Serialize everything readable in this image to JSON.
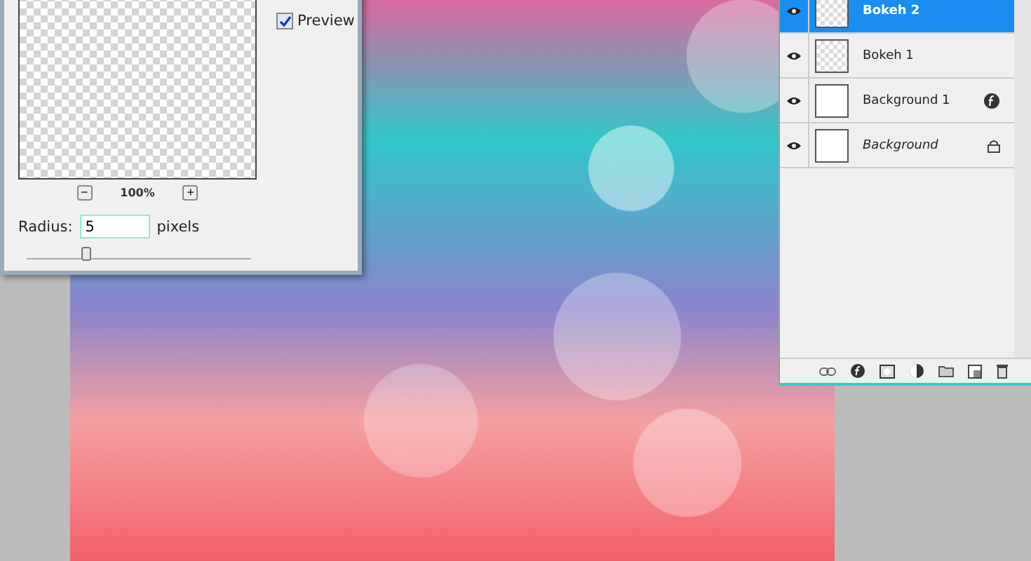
{
  "filter_dialog": {
    "preview": {
      "label": "Preview",
      "checked": true
    },
    "zoom": {
      "minus": "−",
      "level": "100%",
      "plus": "+"
    },
    "radius": {
      "label": "Radius:",
      "value": "5",
      "unit": "pixels",
      "level": 0.27
    }
  },
  "layers_panel": {
    "layers": [
      {
        "name": "Bokeh 2",
        "selected": true,
        "visible": true,
        "kind": "transparent",
        "effects": false,
        "locked": false
      },
      {
        "name": "Bokeh 1",
        "selected": false,
        "visible": true,
        "kind": "transparent",
        "effects": false,
        "locked": false
      },
      {
        "name": "Background 1",
        "selected": false,
        "visible": true,
        "kind": "white",
        "effects": true,
        "locked": false
      },
      {
        "name": "Background",
        "selected": false,
        "visible": true,
        "kind": "white",
        "effects": false,
        "locked": true
      }
    ]
  }
}
